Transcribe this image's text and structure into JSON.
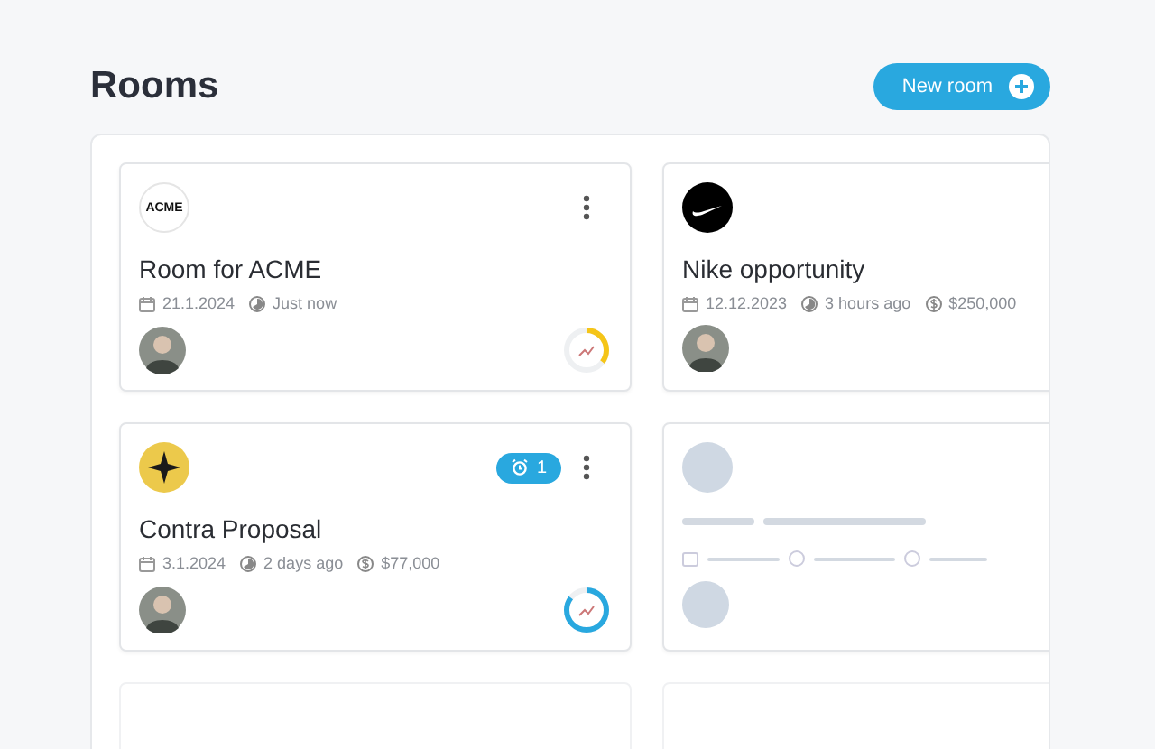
{
  "page": {
    "title": "Rooms"
  },
  "new_room_button": {
    "label": "New room"
  },
  "rooms": [
    {
      "kind": "room",
      "logo": {
        "kind": "text",
        "text": "ACME"
      },
      "title": "Room for ACME",
      "date": "21.1.2024",
      "activity": "Just now",
      "progress": {
        "level": 0.35,
        "color": "#f5c518"
      }
    },
    {
      "kind": "room",
      "logo": {
        "kind": "swoosh"
      },
      "title": "Nike opportunity",
      "date": "12.12.2023",
      "activity": "3 hours ago",
      "value": "$250,000"
    },
    {
      "kind": "room",
      "logo": {
        "kind": "star"
      },
      "title": "Contra Proposal",
      "date": "3.1.2024",
      "activity": "2 days ago",
      "value": "$77,000",
      "alerts": "1",
      "progress": {
        "level": 0.85,
        "color": "#29a8df"
      }
    },
    {
      "kind": "skeleton"
    },
    {
      "kind": "empty"
    },
    {
      "kind": "empty"
    }
  ]
}
